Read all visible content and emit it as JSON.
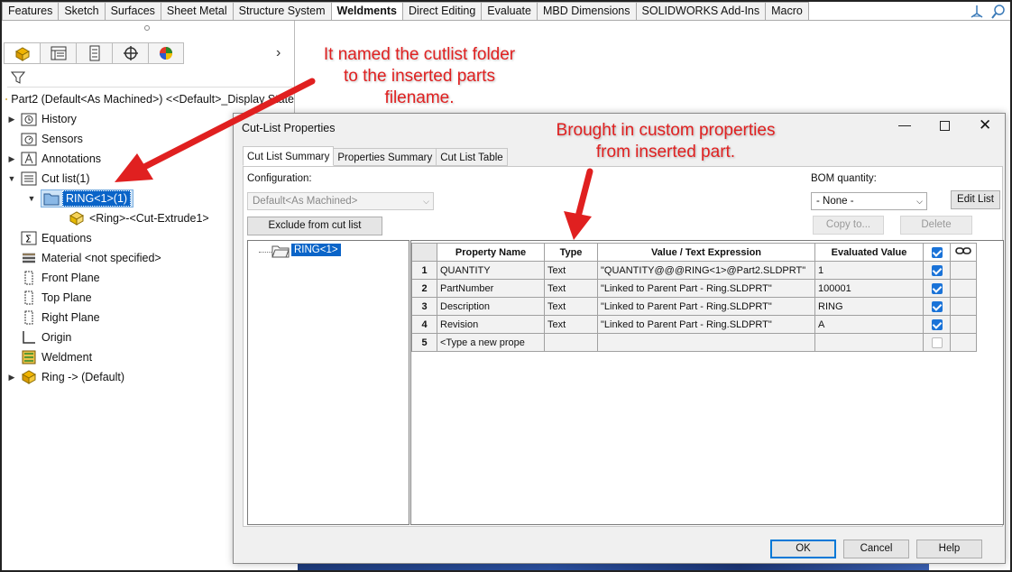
{
  "command_tabs": [
    "Features",
    "Sketch",
    "Surfaces",
    "Sheet Metal",
    "Structure System",
    "Weldments",
    "Direct Editing",
    "Evaluate",
    "MBD Dimensions",
    "SOLIDWORKS Add-Ins",
    "Macro"
  ],
  "active_command_tab": "Weldments",
  "feature_tree": {
    "root": "Part2 (Default<As Machined>) <<Default>_Display State",
    "items": {
      "history": "History",
      "sensors": "Sensors",
      "annotations": "Annotations",
      "cutlist": "Cut list(1)",
      "ring_folder": "RING<1>(1)",
      "ring_body": "<Ring>-<Cut-Extrude1>",
      "equations": "Equations",
      "material": "Material <not specified>",
      "front_plane": "Front Plane",
      "top_plane": "Top Plane",
      "right_plane": "Right Plane",
      "origin": "Origin",
      "weldment": "Weldment",
      "ring_ref": "Ring -> (Default)"
    }
  },
  "dialog": {
    "title": "Cut-List Properties",
    "tabs": [
      "Cut List Summary",
      "Properties Summary",
      "Cut List Table"
    ],
    "configuration_label": "Configuration:",
    "configuration_value": "Default<As Machined>",
    "bom_label": "BOM quantity:",
    "bom_value": "- None -",
    "edit_list": "Edit List",
    "exclude": "Exclude from cut list",
    "copy_to": "Copy to...",
    "delete": "Delete",
    "tree_item": "RING<1>",
    "columns": [
      "Property Name",
      "Type",
      "Value / Text Expression",
      "Evaluated Value"
    ],
    "rows": [
      {
        "num": "1",
        "name": "QUANTITY",
        "type": "Text",
        "value": "\"QUANTITY@@@RING<1>@Part2.SLDPRT\"",
        "evaluated": "1",
        "checked": true
      },
      {
        "num": "2",
        "name": "PartNumber",
        "type": "Text",
        "value": "\"Linked to Parent Part - Ring.SLDPRT\"",
        "evaluated": "100001",
        "checked": true
      },
      {
        "num": "3",
        "name": "Description",
        "type": "Text",
        "value": "\"Linked to Parent Part - Ring.SLDPRT\"",
        "evaluated": "RING",
        "checked": true
      },
      {
        "num": "4",
        "name": "Revision",
        "type": "Text",
        "value": "\"Linked to Parent Part - Ring.SLDPRT\"",
        "evaluated": "A",
        "checked": true
      },
      {
        "num": "5",
        "name": "<Type a new prope",
        "type": "",
        "value": "",
        "evaluated": "",
        "checked": false
      }
    ],
    "ok": "OK",
    "cancel": "Cancel",
    "help": "Help"
  },
  "annotations": {
    "note1": [
      "It named the cutlist folder",
      "to the inserted parts",
      "filename."
    ],
    "note2": [
      "Brought in custom properties",
      "from inserted part."
    ]
  },
  "colors": {
    "annotation_red": "#e02020",
    "selection_blue": "#0a64c8",
    "checkbox_blue": "#1a73d8"
  }
}
